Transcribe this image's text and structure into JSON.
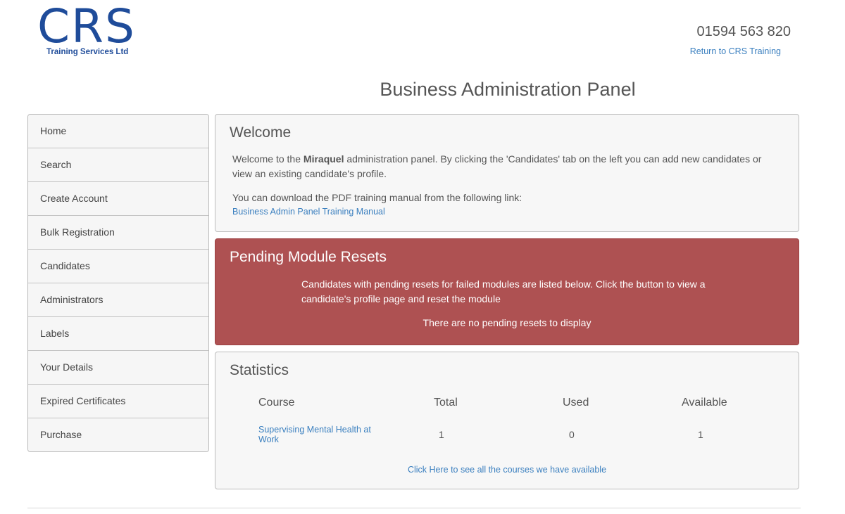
{
  "header": {
    "logo_text": "CRS",
    "logo_subtitle": "Training Services Ltd",
    "phone": "01594 563 820",
    "return_link": "Return to CRS Training",
    "page_title": "Business Administration Panel"
  },
  "sidebar": {
    "items": [
      {
        "label": "Home"
      },
      {
        "label": "Search"
      },
      {
        "label": "Create Account"
      },
      {
        "label": "Bulk Registration"
      },
      {
        "label": "Candidates"
      },
      {
        "label": "Administrators"
      },
      {
        "label": "Labels"
      },
      {
        "label": "Your Details"
      },
      {
        "label": "Expired Certificates"
      },
      {
        "label": "Purchase"
      }
    ]
  },
  "welcome": {
    "title": "Welcome",
    "text_before": "Welcome to the ",
    "brand": "Miraquel",
    "text_after": " administration panel. By clicking the 'Candidates' tab on the left you can add new candidates or view an existing candidate's profile.",
    "download_text": "You can download the PDF training manual from the following link:",
    "manual_link": "Business Admin Panel Training Manual"
  },
  "pending": {
    "title": "Pending Module Resets",
    "description": "Candidates with pending resets for failed modules are listed below. Click the button to view a candidate's profile page and reset the module",
    "empty_message": "There are no pending resets to display"
  },
  "statistics": {
    "title": "Statistics",
    "columns": {
      "course": "Course",
      "total": "Total",
      "used": "Used",
      "available": "Available"
    },
    "rows": [
      {
        "course": "Supervising Mental Health at Work",
        "total": "1",
        "used": "0",
        "available": "1"
      }
    ],
    "more_link": "Click Here to see all the courses we have available"
  },
  "colors": {
    "brand_blue": "#1f4c9a",
    "link_blue": "#3a7fbf",
    "alert_red": "#ae5152"
  }
}
